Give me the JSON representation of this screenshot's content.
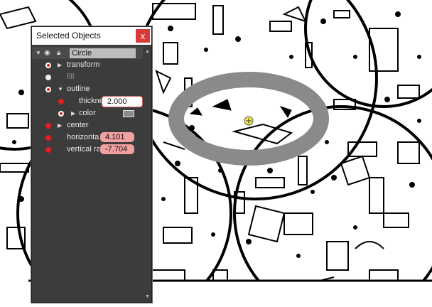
{
  "panel": {
    "title": "Selected Objects",
    "close_label": "x"
  },
  "tree": {
    "object_name": "Circle",
    "rows": {
      "transform": "transform",
      "fill": "fill",
      "outline": "outline",
      "thickness_label": "thickne",
      "thickness_value": "2.000",
      "color_label": "color",
      "center": "center",
      "horizontal_label": "horizonta",
      "horizontal_value": "4.101",
      "vertical_label": "vertical ra",
      "vertical_value": "-7.704"
    }
  },
  "colors": {
    "outline": "#8a8a8a",
    "warning_field": "#f2a0a0",
    "close_button": "#d63a3a"
  }
}
